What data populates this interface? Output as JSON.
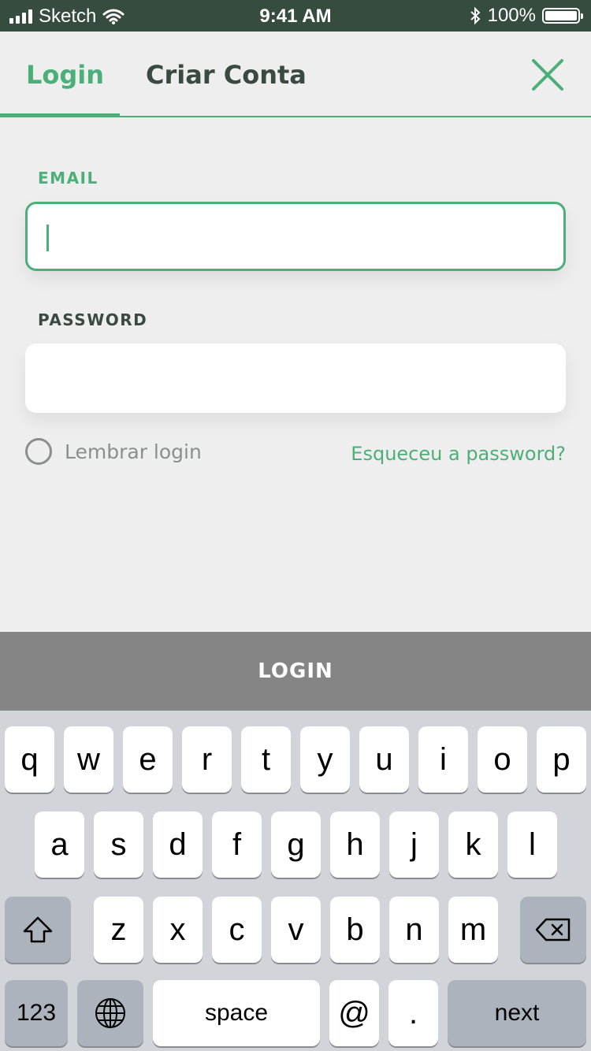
{
  "status_bar": {
    "carrier": "Sketch",
    "time": "9:41 AM",
    "battery": "100%"
  },
  "tabs": {
    "login": "Login",
    "create_account": "Criar Conta",
    "active": "login"
  },
  "form": {
    "email_label": "EMAIL",
    "email_value": "",
    "password_label": "PASSWORD",
    "password_value": "",
    "remember_label": "Lembrar login",
    "remember_checked": false,
    "forgot_link": "Esqueceu a password?"
  },
  "login_button": "LOGIN",
  "keyboard": {
    "row1": [
      "q",
      "w",
      "e",
      "r",
      "t",
      "y",
      "u",
      "i",
      "o",
      "p"
    ],
    "row2": [
      "a",
      "s",
      "d",
      "f",
      "g",
      "h",
      "j",
      "k",
      "l"
    ],
    "row3": [
      "z",
      "x",
      "c",
      "v",
      "b",
      "n",
      "m"
    ],
    "numbers_key": "123",
    "space_key": "space",
    "at_key": "@",
    "dot_key": ".",
    "next_key": "next"
  },
  "colors": {
    "accent": "#4CAF7A",
    "status_bar": "#364C3F",
    "button": "#858585",
    "keyboard_bg": "#D1D4D9"
  }
}
